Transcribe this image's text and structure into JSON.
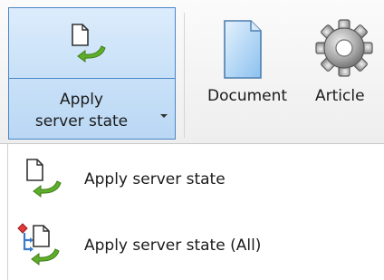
{
  "ribbon": {
    "apply_button": {
      "label_line1": "Apply",
      "label_line2": "server state"
    },
    "document_label": "Document",
    "article_label": "Article"
  },
  "menu": {
    "items": [
      {
        "label": "Apply server state",
        "icon": "document-green-arrow-icon"
      },
      {
        "label": "Apply server state (All)",
        "icon": "hierarchy-green-arrow-icon"
      }
    ]
  },
  "colors": {
    "split_highlight": "#cfe5fa",
    "split_border": "#4a86c8",
    "arrow_green": "#5fae2b"
  }
}
